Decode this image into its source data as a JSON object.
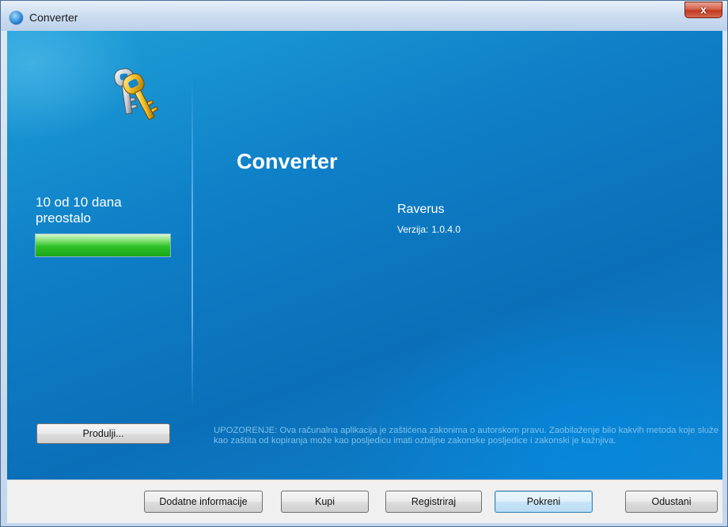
{
  "window": {
    "title": "Converter",
    "close_label": "x"
  },
  "sidebar": {
    "trial_line1": "10 od 10 dana",
    "trial_line2": "preostalo",
    "trial_progress": 1.0,
    "extend_button": "Produlji..."
  },
  "main": {
    "product_title": "Converter",
    "company": "Raverus",
    "version_label": "Verzija:",
    "version_value": "1.0.4.0",
    "warning": "UPOZORENJE: Ova računalna aplikacija je zaštićena zakonima o autorskom pravu. Zaobilaženje bilo kakvih metoda koje služe kao zaštita od kopiranja može kao posljedicu imati ozbiljne zakonske posljedice i zakonski je kažnjiva."
  },
  "buttons": {
    "more_info": "Dodatne informacije",
    "buy": "Kupi",
    "register": "Registriraj",
    "run": "Pokreni",
    "cancel": "Odustani"
  },
  "colors": {
    "background": "#0f7fc7",
    "progress": "#2fc22a",
    "warning_text": "#7ec0ea"
  },
  "icons": {
    "app": "app-icon",
    "keys": "keys-icon",
    "close": "close-icon"
  }
}
